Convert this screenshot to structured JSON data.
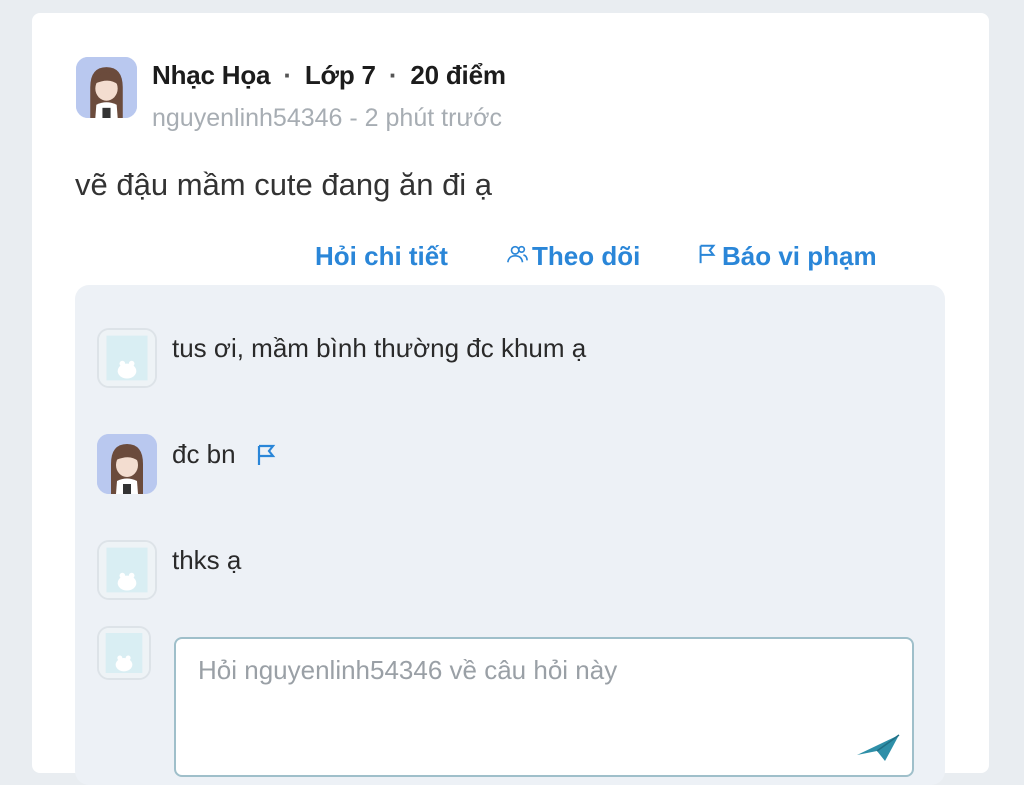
{
  "post": {
    "subject": "Nhạc Họa",
    "grade": "Lớp 7",
    "points": "20 điểm",
    "separator": "·",
    "author": "nguyenlinh54346",
    "time": "2 phút trước",
    "byline": "nguyenlinh54346 - 2 phút trước",
    "question": "vẽ đậu mầm cute đang ăn đi ạ"
  },
  "actions": {
    "ask_detail": "Hỏi chi tiết",
    "follow": "Theo dõi",
    "report": "Báo vi phạm"
  },
  "comments": [
    {
      "text": "tus ơi, mầm bình thường đc khum ạ",
      "avatar": "bear-avatar"
    },
    {
      "text": "đc bn",
      "avatar": "girl-avatar",
      "has_report_flag": true
    },
    {
      "text": "thks ạ",
      "avatar": "bear-avatar"
    }
  ],
  "reply": {
    "placeholder": "Hỏi nguyenlinh54346 về câu hỏi này",
    "value": ""
  },
  "icons": {
    "follow": "follow-users-icon",
    "report": "flag-icon",
    "send": "send-icon"
  },
  "colors": {
    "accent": "#2a86d8",
    "page_background": "#e9edf1",
    "comments_background": "#edf1f6",
    "input_border": "#9fbfca",
    "send_icon": "#2e8fa8"
  }
}
